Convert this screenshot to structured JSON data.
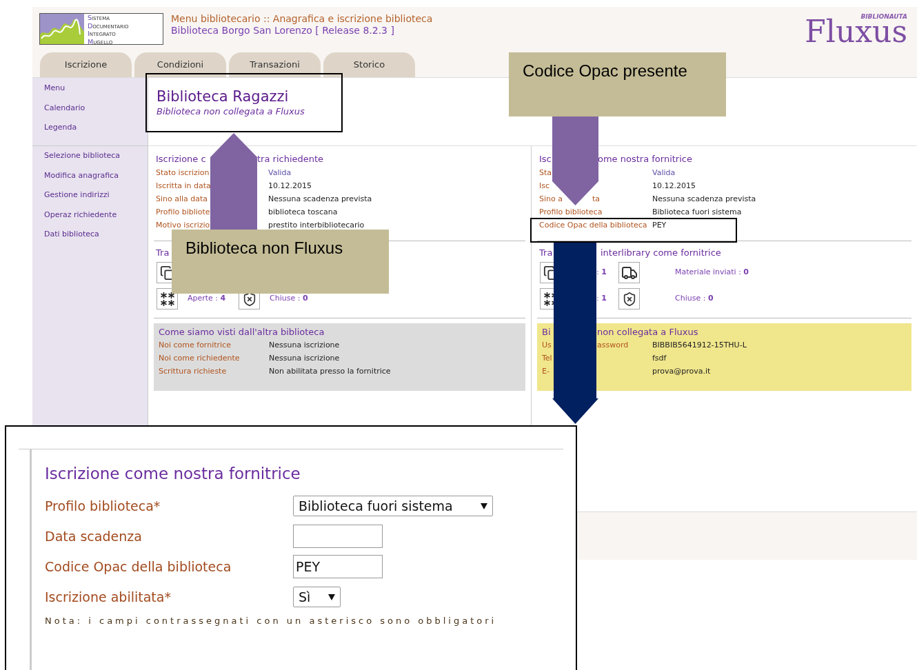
{
  "header": {
    "logo_lines": [
      "SISTEMA",
      "DOCUMENTARIO",
      "INTEGRATO",
      "MUGELLO"
    ],
    "menu_path": "Menu bibliotecario :: Anagrafica e iscrizione biblioteca",
    "library": "Biblioteca Borgo San Lorenzo [ Release 8.2.3 ]",
    "brand": "Fluxus",
    "brand_tag": "BIBLIONAUTA"
  },
  "tabs": [
    "Iscrizione",
    "Condizioni",
    "Transazioni",
    "Storico"
  ],
  "sidebar": {
    "groups": [
      [
        "Menu",
        "Calendario",
        "Legenda"
      ],
      [
        "Selezione biblioteca",
        "Modifica anagrafica",
        "Gestione indirizzi",
        "Operaz richiedente",
        "Dati biblioteca"
      ]
    ]
  },
  "library_title": {
    "name": "Biblioteca Ragazzi",
    "subtitle": "Biblioteca non collegata a Fluxus"
  },
  "columns": [
    {
      "registration": {
        "title": [
          "Iscrizione c",
          "tra richiedente"
        ],
        "rows": [
          {
            "label": [
              "Stato iscrizion"
            ],
            "value": "Valida",
            "kind": "status"
          },
          {
            "label": [
              "Iscritta in data"
            ],
            "value": "10.12.2015",
            "kind": "text"
          },
          {
            "label": [
              "Sino alla data"
            ],
            "value": "Nessuna scadenza prevista",
            "kind": "text"
          },
          {
            "label": [
              "Profilo bibliote"
            ],
            "value": "biblioteca toscana",
            "kind": "text"
          },
          {
            "label": [
              "Motivo iscrizio"
            ],
            "value": "prestito interbibliotecario",
            "kind": "text"
          }
        ]
      },
      "stats": {
        "title": [
          "Tra"
        ],
        "rows": [
          [
            {
              "kind": "copy"
            }
          ],
          [
            {
              "kind": "asterisks",
              "text": "Aperte : **4**"
            },
            {
              "kind": "shield",
              "text": "Chiuse : **0**"
            }
          ]
        ]
      },
      "panel": {
        "kind": "grey",
        "title": [
          "Come siamo visti dall'altra biblioteca"
        ],
        "rows": [
          {
            "label": [
              "Noi come fornitrice"
            ],
            "value": "Nessuna iscrizione"
          },
          {
            "label": [
              "Noi come richiedente"
            ],
            "value": "Nessuna iscrizione"
          },
          {
            "label": [
              "Scrittura richieste"
            ],
            "value": "Non abilitata presso la fornitrice"
          }
        ]
      }
    },
    {
      "registration": {
        "title": [
          "Isc",
          "ome nostra fornitrice"
        ],
        "rows": [
          {
            "label": [
              "Sta"
            ],
            "value": "Valida",
            "kind": "status"
          },
          {
            "label": [
              "Isc"
            ],
            "value": "10.12.2015",
            "kind": "text"
          },
          {
            "label": [
              "Sino a",
              "ta"
            ],
            "value": "Nessuna scadenza prevista",
            "kind": "text"
          },
          {
            "label": [
              "Profilo biblioteca"
            ],
            "value": "Biblioteca fuori sistema",
            "kind": "text"
          },
          {
            "label": [
              "Codice Opac della biblioteca"
            ],
            "value": "PEY",
            "kind": "text"
          }
        ]
      },
      "stats": {
        "title": [
          "Tra",
          "interlibrary come fornitrice"
        ],
        "rows": [
          [
            {
              "kind": "copy",
              "text": ": **1**"
            },
            {
              "kind": "truck",
              "text": "Materiale inviati : **0**"
            }
          ],
          [
            {
              "kind": "asterisks",
              "text": ": **1**"
            },
            {
              "kind": "shield",
              "text": "Chiuse : **0**"
            }
          ]
        ]
      },
      "panel": {
        "kind": "yellow",
        "title": [
          "Bi",
          "non collegata a Fluxus"
        ],
        "rows": [
          {
            "label": [
              "Us",
              "assword"
            ],
            "value": "BIBBIB5641912-15THU-L"
          },
          {
            "label": [
              "Tel"
            ],
            "value": "fsdf"
          },
          {
            "label": [
              "E-"
            ],
            "value": "prova@prova.it"
          }
        ]
      }
    }
  ],
  "callouts": [
    "Codice Opac presente",
    "Biblioteca non Fluxus"
  ],
  "zoom_panel": {
    "title": "Iscrizione come nostra fornitrice",
    "fields": [
      {
        "label": "Profilo biblioteca*",
        "kind": "select",
        "value": "Biblioteca fuori sistema"
      },
      {
        "label": "Data scadenza",
        "kind": "input"
      },
      {
        "label": "Codice Opac della biblioteca",
        "kind": "input",
        "value": "PEY"
      },
      {
        "label": "Iscrizione abilitata*",
        "kind": "select",
        "value": "Sì"
      }
    ],
    "note": "Nota: i campi contrassegnati con un asterisco sono obbligatori"
  }
}
